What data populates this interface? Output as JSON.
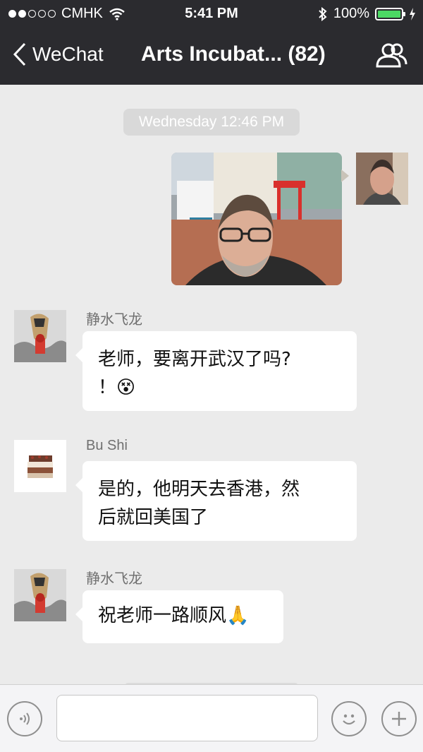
{
  "status_bar": {
    "carrier": "CMHK",
    "time": "5:41 PM",
    "battery": "100%"
  },
  "nav": {
    "back_label": "WeChat",
    "title": "Arts Incubat... (82)"
  },
  "chat": {
    "timestamp": "Wednesday 12:46 PM",
    "messages": [
      {
        "sender": "",
        "text": ""
      },
      {
        "sender": "静水飞龙",
        "text": "老师，要离开武汉了吗?\n！😵"
      },
      {
        "sender": "Bu Shi",
        "text": "是的，他明天去香港，然\n后就回美国了"
      },
      {
        "sender": "静水飞龙",
        "text": "祝老师一路顺风🙏"
      }
    ]
  },
  "input_bar": {
    "placeholder": ""
  }
}
